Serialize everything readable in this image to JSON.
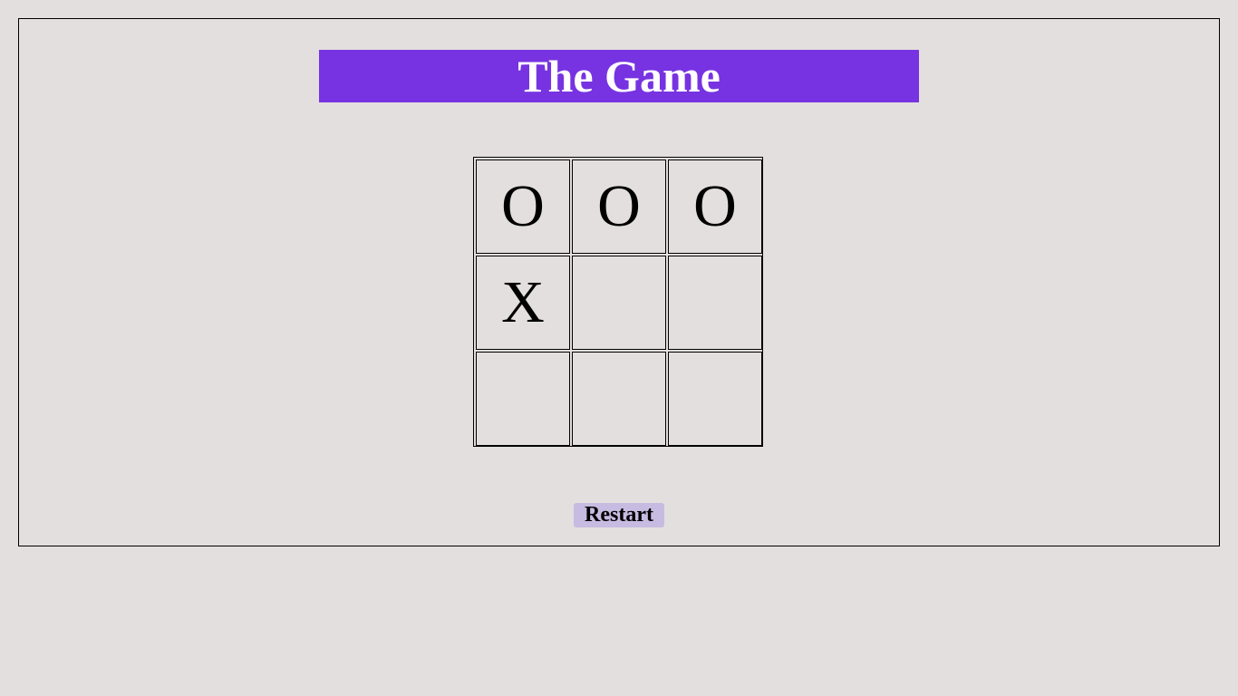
{
  "title": "The Game",
  "board": {
    "cells": [
      "O",
      "O",
      "O",
      "X",
      "",
      "",
      "",
      "",
      ""
    ]
  },
  "restart_label": "Restart",
  "colors": {
    "page_background": "#e3dfde",
    "title_background": "#7733e1",
    "title_text": "#ffffff",
    "button_background": "#c7bbe1"
  }
}
